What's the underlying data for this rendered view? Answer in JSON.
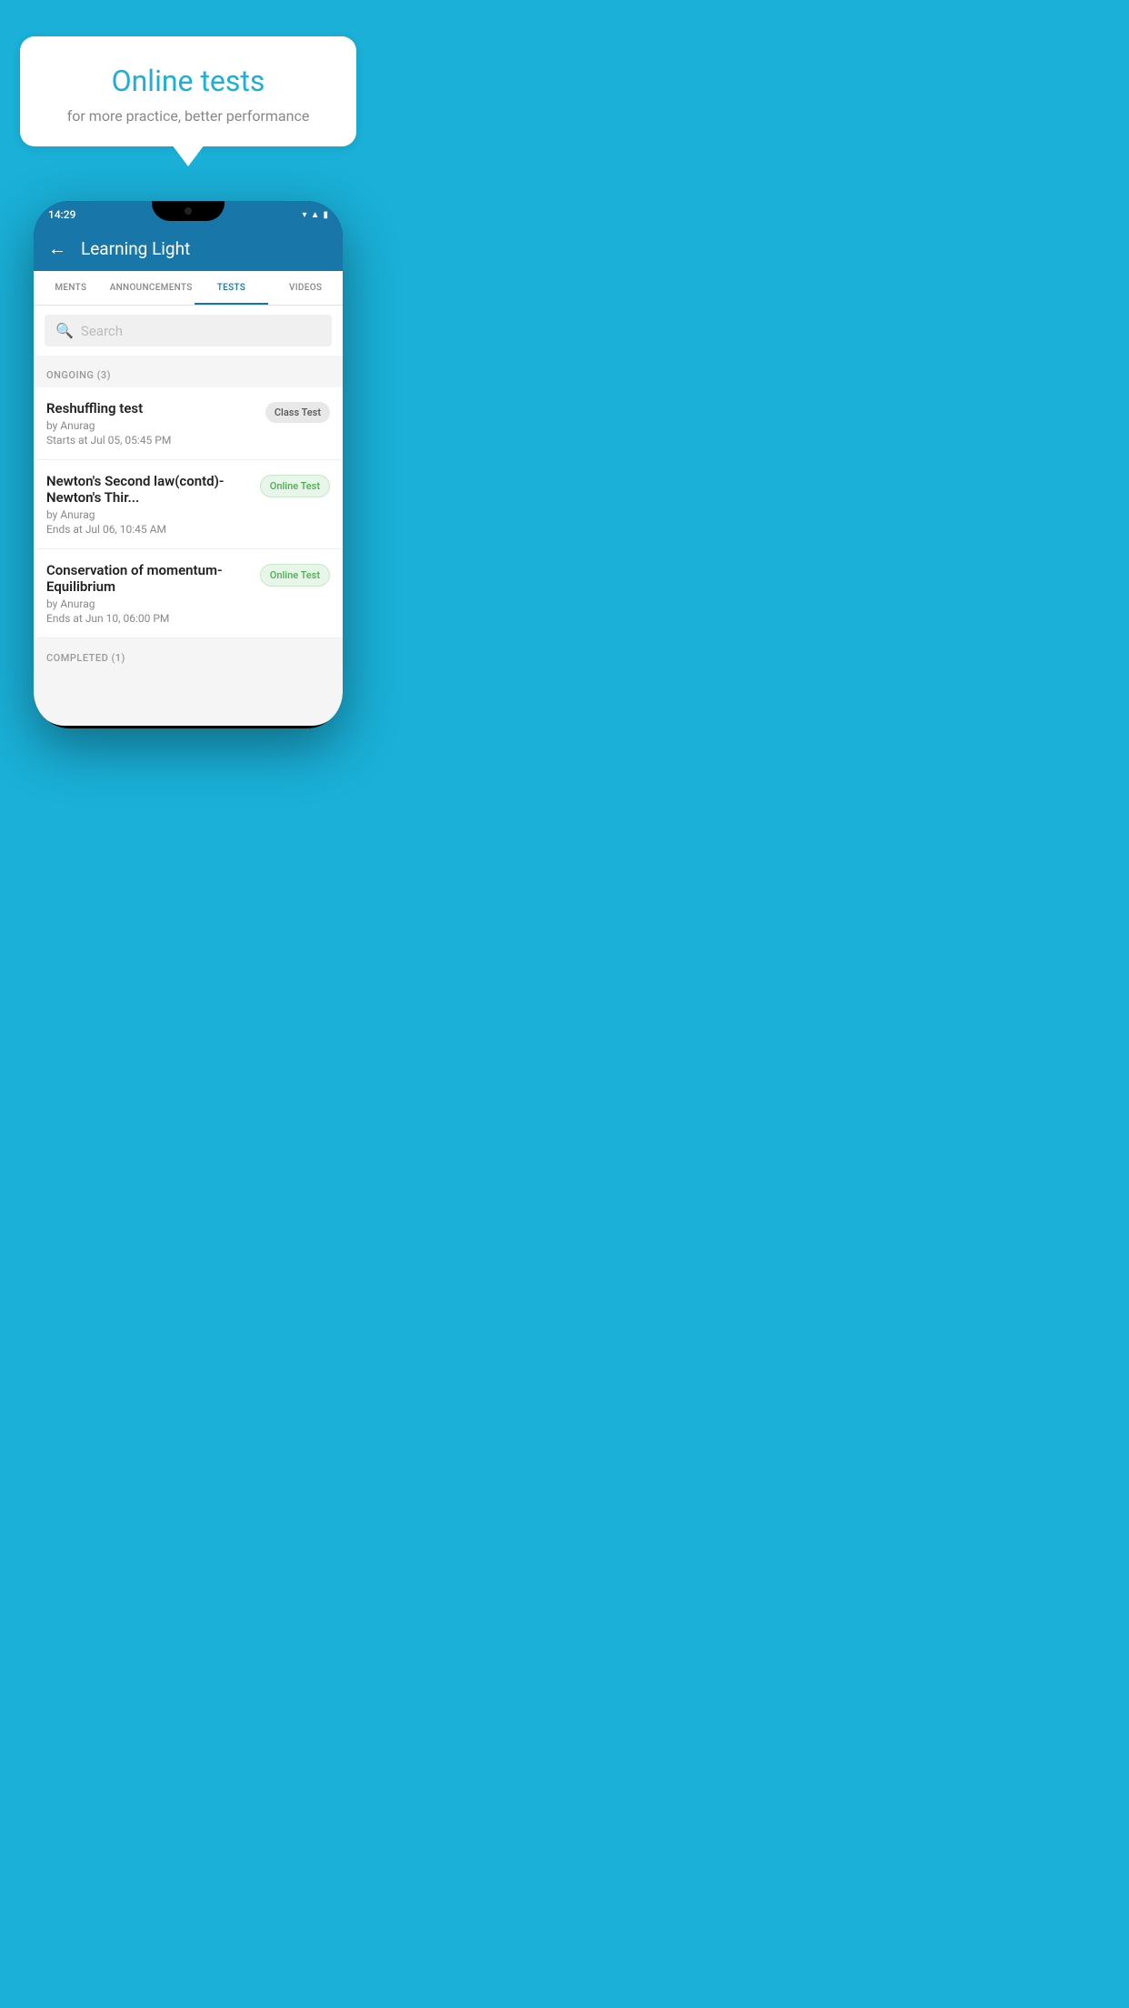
{
  "background_color": "#1ab0d8",
  "bubble": {
    "title": "Online tests",
    "subtitle": "for more practice, better performance"
  },
  "phone": {
    "status_bar": {
      "time": "14:29",
      "icons": [
        "wifi",
        "signal",
        "battery"
      ]
    },
    "toolbar": {
      "title": "Learning Light",
      "back_label": "←"
    },
    "tabs": [
      {
        "label": "MENTS",
        "active": false
      },
      {
        "label": "ANNOUNCEMENTS",
        "active": false
      },
      {
        "label": "TESTS",
        "active": true
      },
      {
        "label": "VIDEOS",
        "active": false
      }
    ],
    "search": {
      "placeholder": "Search"
    },
    "ongoing_section": {
      "label": "ONGOING (3)"
    },
    "tests": [
      {
        "name": "Reshuffling test",
        "by": "by Anurag",
        "date": "Starts at  Jul 05, 05:45 PM",
        "badge": "Class Test",
        "badge_type": "class"
      },
      {
        "name": "Newton's Second law(contd)-Newton's Thir...",
        "by": "by Anurag",
        "date": "Ends at  Jul 06, 10:45 AM",
        "badge": "Online Test",
        "badge_type": "online"
      },
      {
        "name": "Conservation of momentum-Equilibrium",
        "by": "by Anurag",
        "date": "Ends at  Jun 10, 06:00 PM",
        "badge": "Online Test",
        "badge_type": "online"
      }
    ],
    "completed_section": {
      "label": "COMPLETED (1)"
    }
  }
}
